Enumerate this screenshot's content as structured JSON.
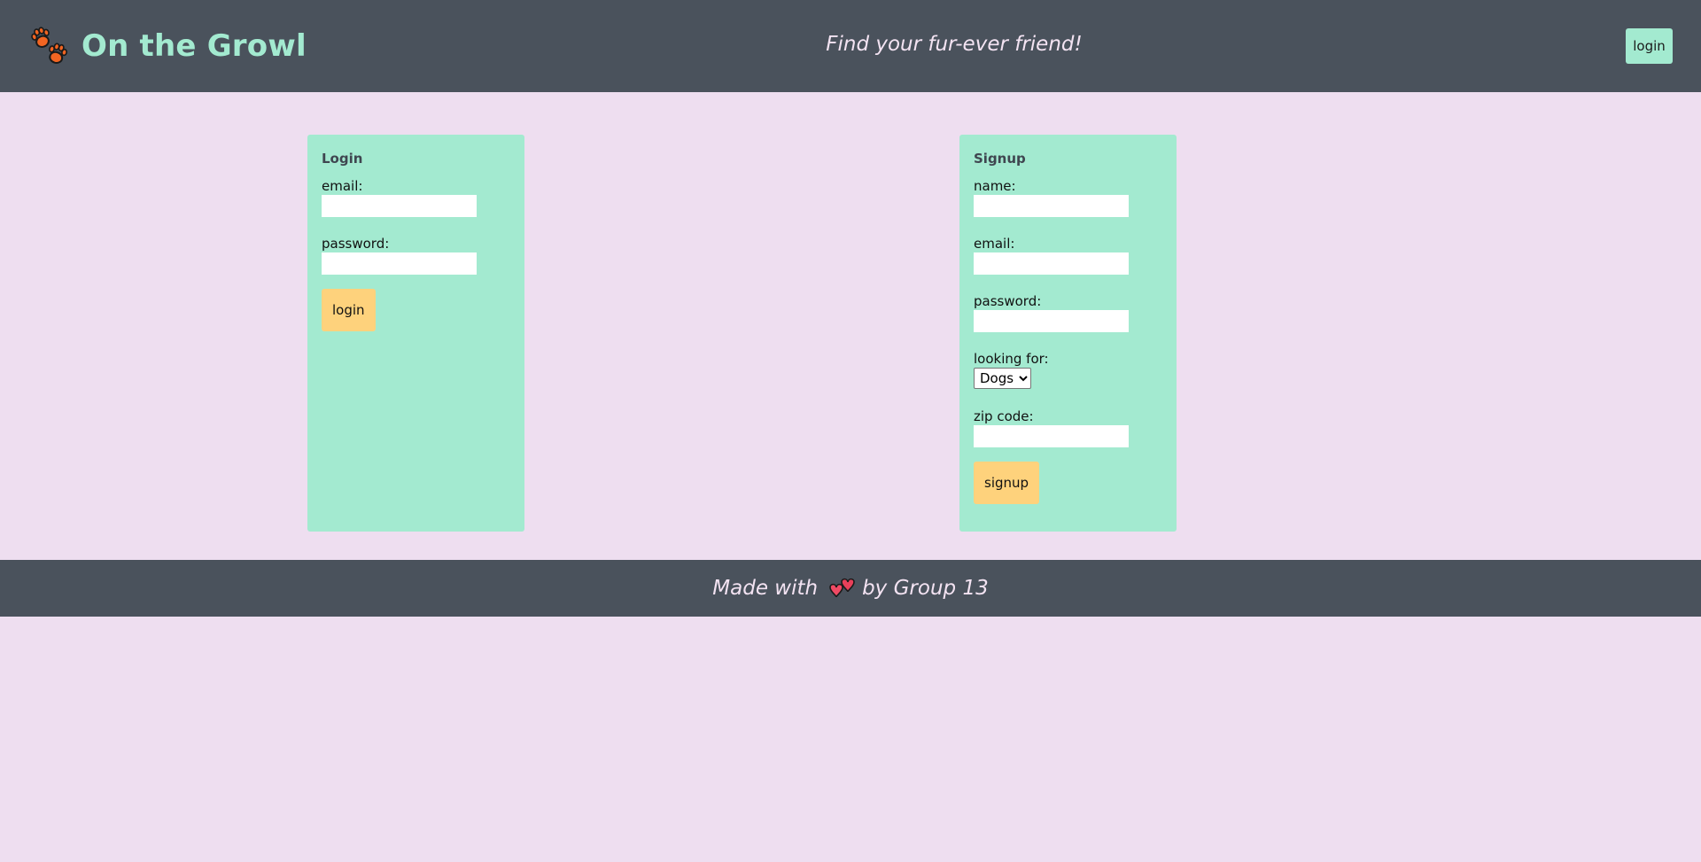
{
  "header": {
    "title": "On the Growl",
    "tagline": "Find your fur-ever friend!",
    "login_button": "login",
    "logo_icon": "paw-prints-icon",
    "colors": {
      "bar": "#4a525c",
      "brand": "#a3ead0",
      "paw": "#f26522"
    }
  },
  "login_card": {
    "title": "Login",
    "email_label": "email:",
    "email_value": "",
    "password_label": "password:",
    "password_value": "",
    "submit_label": "login"
  },
  "signup_card": {
    "title": "Signup",
    "name_label": "name:",
    "name_value": "",
    "email_label": "email:",
    "email_value": "",
    "password_label": "password:",
    "password_value": "",
    "looking_for_label": "looking for:",
    "looking_for_selected": "Dogs",
    "zip_label": "zip code:",
    "zip_value": "",
    "submit_label": "signup"
  },
  "footer": {
    "prefix": "Made with",
    "suffix": "by Group 13",
    "heart_icon": "two-hearts-icon"
  },
  "theme": {
    "background": "#eedef0",
    "card": "#a3ead0",
    "button": "#fed27c",
    "text_light": "#f3e3f2"
  }
}
